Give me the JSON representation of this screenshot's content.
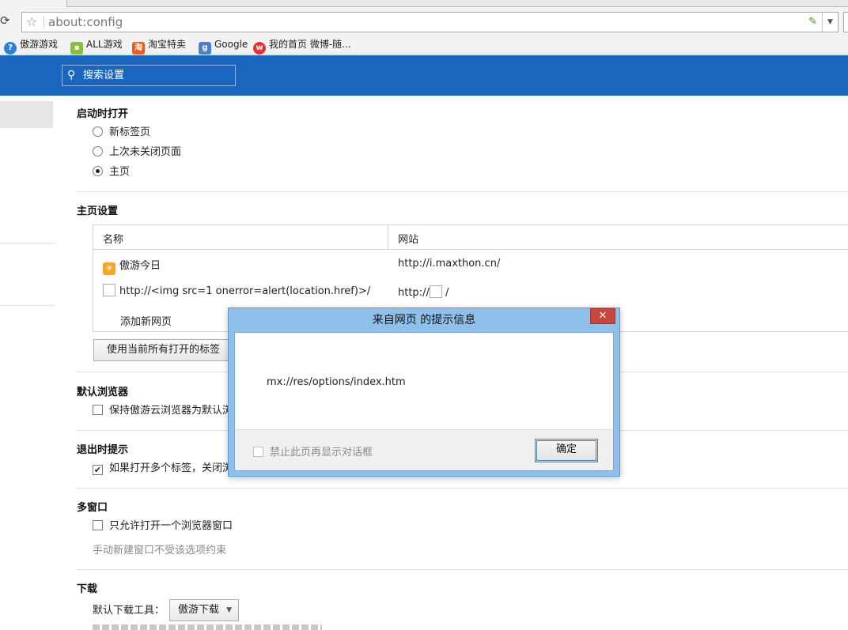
{
  "browser": {
    "address": "about:config",
    "reload_glyph": "⟳",
    "star_glyph": "☆",
    "bookmarks": [
      {
        "label": "傲游游戏",
        "icon": "maxthon-icon"
      },
      {
        "label": "ALL游戏",
        "icon": "bag-icon"
      },
      {
        "label": "淘宝特卖",
        "icon": "taobao-icon"
      },
      {
        "label": "Google",
        "icon": "google-icon"
      },
      {
        "label": "我的首页 微博-随...",
        "icon": "weibo-icon"
      }
    ]
  },
  "header": {
    "search_placeholder": "搜索设置",
    "color": "#1a66bf"
  },
  "startup": {
    "title": "启动时打开",
    "options": [
      {
        "label": "新标签页",
        "selected": false
      },
      {
        "label": "上次未关闭页面",
        "selected": false
      },
      {
        "label": "主页",
        "selected": true
      }
    ]
  },
  "homepage": {
    "title": "主页设置",
    "col_name": "名称",
    "col_site": "网站",
    "rows": [
      {
        "name": "傲游今日",
        "url": "http://i.maxthon.cn/"
      },
      {
        "name": "http://<img src=1 onerror=alert(location.href)>/",
        "url_prefix": "http://",
        "url_suffix": " /"
      }
    ],
    "add_label": "添加新网页",
    "use_tabs_button": "使用当前所有打开的标签"
  },
  "default_browser": {
    "title": "默认浏览器",
    "option": "保持傲游云浏览器为默认浏"
  },
  "exit": {
    "title": "退出时提示",
    "option": "如果打开多个标签，关闭浏"
  },
  "multi_window": {
    "title": "多窗口",
    "option": "只允许打开一个浏览器窗口",
    "hint": "手动新建窗口不受该选项约束"
  },
  "download": {
    "title": "下载",
    "tool_label": "默认下载工具：",
    "tool_value": "傲游下载"
  },
  "dialog": {
    "title": "来自网页  的提示信息",
    "close_glyph": "✕",
    "message": "mx://res/options/index.htm",
    "suppress_label": "禁止此页再显示对话框",
    "ok_label": "确定"
  }
}
